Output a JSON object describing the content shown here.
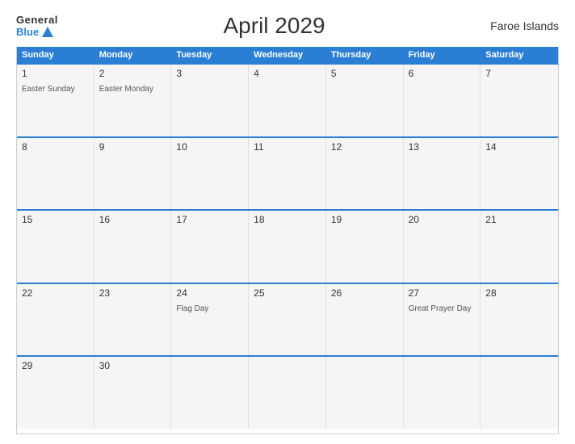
{
  "header": {
    "logo_general": "General",
    "logo_blue": "Blue",
    "title": "April 2029",
    "region": "Faroe Islands"
  },
  "days": {
    "headers": [
      "Sunday",
      "Monday",
      "Tuesday",
      "Wednesday",
      "Thursday",
      "Friday",
      "Saturday"
    ]
  },
  "weeks": [
    [
      {
        "num": "1",
        "event": "Easter Sunday"
      },
      {
        "num": "2",
        "event": "Easter Monday"
      },
      {
        "num": "3",
        "event": ""
      },
      {
        "num": "4",
        "event": ""
      },
      {
        "num": "5",
        "event": ""
      },
      {
        "num": "6",
        "event": ""
      },
      {
        "num": "7",
        "event": ""
      }
    ],
    [
      {
        "num": "8",
        "event": ""
      },
      {
        "num": "9",
        "event": ""
      },
      {
        "num": "10",
        "event": ""
      },
      {
        "num": "11",
        "event": ""
      },
      {
        "num": "12",
        "event": ""
      },
      {
        "num": "13",
        "event": ""
      },
      {
        "num": "14",
        "event": ""
      }
    ],
    [
      {
        "num": "15",
        "event": ""
      },
      {
        "num": "16",
        "event": ""
      },
      {
        "num": "17",
        "event": ""
      },
      {
        "num": "18",
        "event": ""
      },
      {
        "num": "19",
        "event": ""
      },
      {
        "num": "20",
        "event": ""
      },
      {
        "num": "21",
        "event": ""
      }
    ],
    [
      {
        "num": "22",
        "event": ""
      },
      {
        "num": "23",
        "event": ""
      },
      {
        "num": "24",
        "event": "Flag Day"
      },
      {
        "num": "25",
        "event": ""
      },
      {
        "num": "26",
        "event": ""
      },
      {
        "num": "27",
        "event": "Great Prayer Day"
      },
      {
        "num": "28",
        "event": ""
      }
    ],
    [
      {
        "num": "29",
        "event": ""
      },
      {
        "num": "30",
        "event": ""
      },
      {
        "num": "",
        "event": ""
      },
      {
        "num": "",
        "event": ""
      },
      {
        "num": "",
        "event": ""
      },
      {
        "num": "",
        "event": ""
      },
      {
        "num": "",
        "event": ""
      }
    ]
  ]
}
